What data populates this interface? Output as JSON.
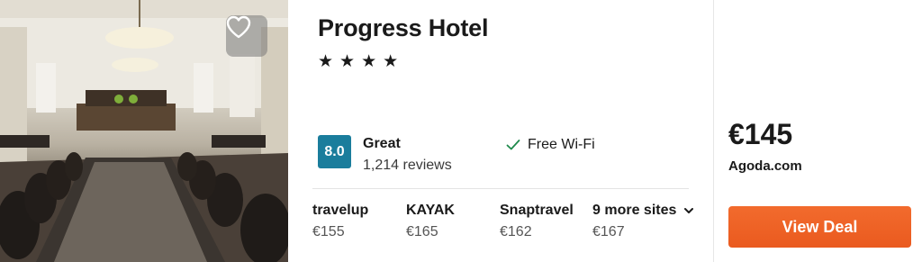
{
  "hotel": {
    "name": "Progress Hotel",
    "star_count": 4,
    "star_glyph": "★"
  },
  "rating": {
    "score": "8.0",
    "label": "Great",
    "reviews": "1,214 reviews",
    "badge_color": "#1a7d9c"
  },
  "amenity": {
    "label": "Free Wi-Fi",
    "icon": "checkmark-icon"
  },
  "providers": [
    {
      "name": "travelup",
      "price": "€155"
    },
    {
      "name": "KAYAK",
      "price": "€165"
    },
    {
      "name": "Snaptravel",
      "price": "€162"
    },
    {
      "name": "9 more sites",
      "price": "€167",
      "icon": "chevron-down-icon"
    }
  ],
  "deal": {
    "price": "€145",
    "site": "Agoda.com",
    "button_label": "View Deal",
    "button_color": "#ea5a1f"
  },
  "photo": {
    "icon": "heart-icon"
  }
}
